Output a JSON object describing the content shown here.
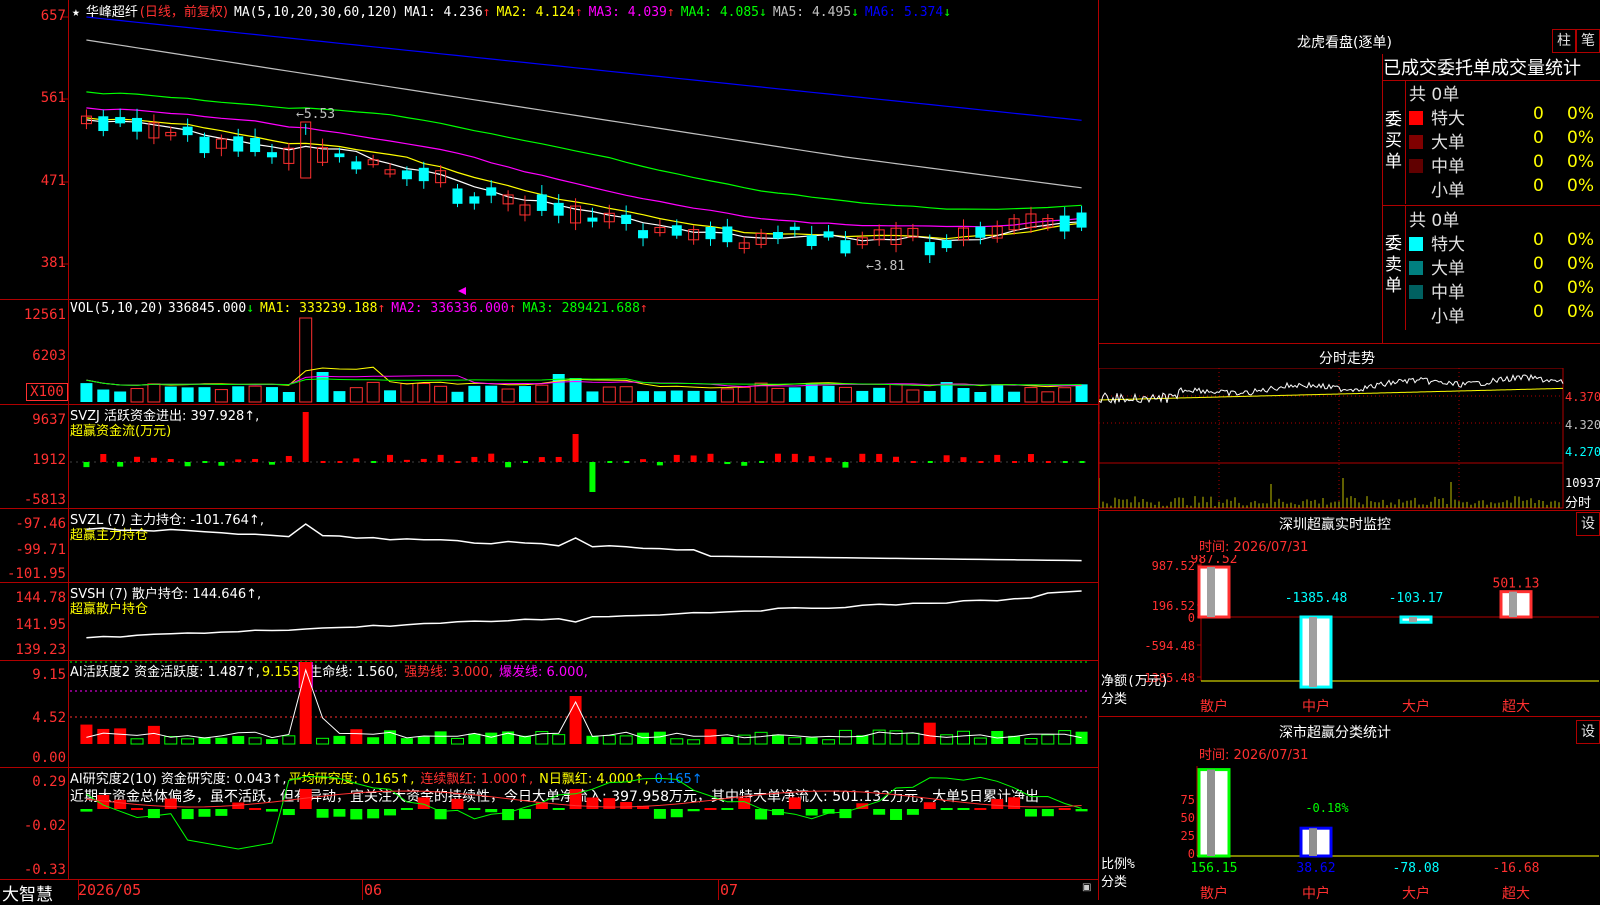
{
  "stock": {
    "name": "华峰超纤",
    "period": "(日线，前复权)",
    "star": "★"
  },
  "ma_row": {
    "params": "MA(5,10,20,30,60,120)",
    "items": [
      {
        "label": "MA1:",
        "value": "4.236",
        "arrow": "↑",
        "color": "#ffffff"
      },
      {
        "label": "MA2:",
        "value": "4.124",
        "arrow": "↑",
        "color": "#ffff00"
      },
      {
        "label": "MA3:",
        "value": "4.039",
        "arrow": "↑",
        "color": "#ff00ff"
      },
      {
        "label": "MA4:",
        "value": "4.085",
        "arrow": "↓",
        "color": "#00ff00"
      },
      {
        "label": "MA5:",
        "value": "4.495",
        "arrow": "↓",
        "color": "#c0c0c0"
      },
      {
        "label": "MA6:",
        "value": "5.374",
        "arrow": "↓",
        "color": "#0000ff"
      }
    ]
  },
  "price_axis": [
    "657",
    "561",
    "471",
    "381"
  ],
  "price_marks": {
    "high": "5.53",
    "low": "3.81"
  },
  "vol": {
    "params": "VOL(5,10,20)",
    "value": "336845.000",
    "arrow": "↓",
    "items": [
      {
        "label": "MA1:",
        "value": "333239.188",
        "arrow": "↑",
        "color": "#ffff00"
      },
      {
        "label": "MA2:",
        "value": "336336.000",
        "arrow": "↑",
        "color": "#ff00ff"
      },
      {
        "label": "MA3:",
        "value": "289421.688",
        "arrow": "↑",
        "color": "#00ff00"
      }
    ],
    "axis": [
      "12561",
      "6203",
      "X100"
    ]
  },
  "svzj": {
    "title": "SVZJ  活跃资金进出: 397.928↑,",
    "sub": "超赢资金流(万元)",
    "axis": [
      "9637",
      "1912",
      "-5813"
    ]
  },
  "svzl": {
    "title": "SVZL (7) 主力持仓: -101.764↑,",
    "sub": "超赢主力持仓",
    "axis": [
      "-97.46",
      "-99.71",
      "-101.95"
    ]
  },
  "svsh": {
    "title": "SVSH (7) 散户持仓: 144.646↑,",
    "sub": "超赢散户持仓",
    "axis": [
      "144.78",
      "141.95",
      "139.23"
    ]
  },
  "ai1": {
    "label": "AI活跃度2 资金活跃度: 1.487↑,",
    "v2": "9.153,",
    "v3": "生命线: 1.560,",
    "v4": "强势线: 3.000,",
    "v5": "爆发线: 6.000,",
    "axis": [
      "9.15",
      "4.52",
      "0.00"
    ]
  },
  "ai2": {
    "label": "AI研究度2(10) 资金研究度: 0.043↑,",
    "v2": "平均研究度: 0.165↑,",
    "v3": "连续飘红: 1.000↑,",
    "v4": "N日飘红: 4.000↑,",
    "v5": "0.165↑",
    "text": "近期大资金总体偏多，虽不活跃，但有异动，宜关注大资金的持续性，今日大单净流入: 397.958万元，其中特大单净流入: 501.132万元，大单5日累计净出",
    "axis": [
      "0.29",
      "-0.02",
      "-0.33"
    ]
  },
  "bottom": {
    "brand": "大智慧",
    "dates": [
      "2026/05",
      "06",
      "07"
    ]
  },
  "right": {
    "dragon_title": "龙虎看盘(逐单)",
    "btn1": "柱",
    "btn2": "笔",
    "stats_title": "已成交委托单成交量统计",
    "buy": {
      "side": "委买单",
      "total": "共 0单",
      "rows": [
        {
          "name": "特大",
          "count": "0",
          "pct": "0%",
          "color": "#ff0000"
        },
        {
          "name": "大单",
          "count": "0",
          "pct": "0%",
          "color": "#800000"
        },
        {
          "name": "中单",
          "count": "0",
          "pct": "0%",
          "color": "#600000"
        },
        {
          "name": "小单",
          "count": "0",
          "pct": "0%",
          "color": "#000000"
        }
      ]
    },
    "sell": {
      "side": "委卖单",
      "total": "共 0单",
      "rows": [
        {
          "name": "特大",
          "count": "0",
          "pct": "0%",
          "color": "#00ffff"
        },
        {
          "name": "大单",
          "count": "0",
          "pct": "0%",
          "color": "#008080"
        },
        {
          "name": "中单",
          "count": "0",
          "pct": "0%",
          "color": "#006060"
        },
        {
          "name": "小单",
          "count": "0",
          "pct": "0%",
          "color": "#000000"
        }
      ]
    },
    "intraday": {
      "title": "分时走势",
      "axis": [
        "4.370",
        "4.320",
        "4.270",
        "10937",
        "分时"
      ]
    },
    "monitor": {
      "title": "深圳超赢实时监控",
      "btn": "设",
      "time": "时间: 2026/07/31",
      "axis": [
        "987.52",
        "196.52",
        "0",
        "-594.48",
        "-1385.48"
      ],
      "ylabel": "净额(万元)",
      "xlabel": "分类",
      "bars": [
        {
          "cat": "散户",
          "value": "987.52"
        },
        {
          "cat": "中户",
          "value": "-1385.48"
        },
        {
          "cat": "大户",
          "value": "-103.17"
        },
        {
          "cat": "超大",
          "value": "501.13"
        }
      ]
    },
    "classify": {
      "title": "深市超赢分类统计",
      "btn": "设",
      "time": "时间: 2026/07/31",
      "axis": [
        "75",
        "50",
        "25",
        "0"
      ],
      "ylabel": "比例%",
      "xlabel": "分类",
      "mid_label": "-0.18%",
      "bars": [
        {
          "cat": "散户",
          "value": "156.15"
        },
        {
          "cat": "中户",
          "value": "38.62"
        },
        {
          "cat": "大户",
          "value": "-78.08"
        },
        {
          "cat": "超大",
          "value": "-16.68"
        }
      ]
    }
  }
}
